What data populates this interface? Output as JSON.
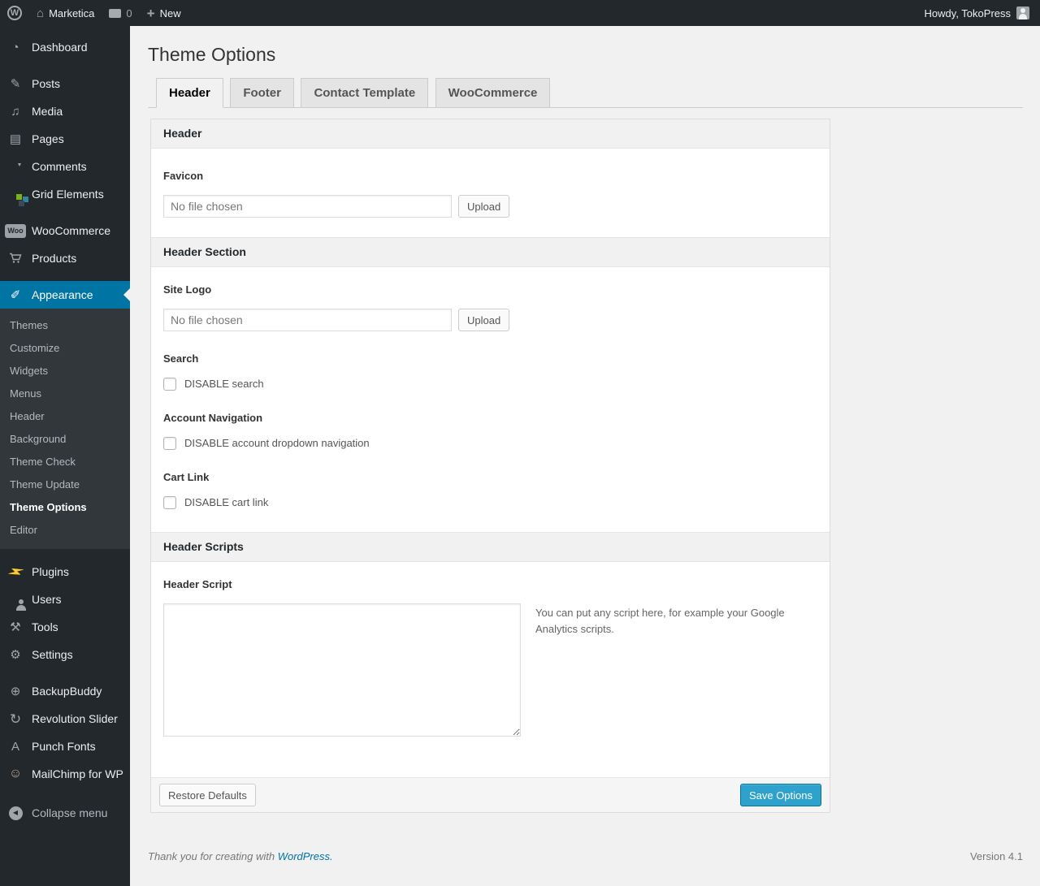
{
  "colors": {
    "accent": "#0074a2",
    "primary_button": "#2ea2cc",
    "admin_dark": "#23282d"
  },
  "admin_bar": {
    "site_name": "Marketica",
    "comment_count": "0",
    "new_label": "New",
    "howdy": "Howdy, TokoPress"
  },
  "icons": {
    "wordpress_logo": "W",
    "home": "⌂",
    "plus": "+",
    "dashboard": "◔",
    "posts": "✎",
    "media": "♫",
    "pages": "▤",
    "woo_badge": "Woo",
    "appearance": "✐",
    "plugins": "⚡",
    "tools": "⚒",
    "settings": "⚙",
    "backupbuddy": "⊕",
    "revolution_slider": "↻",
    "punch_fonts": "A",
    "mailchimp": "☺",
    "collapse": "◀"
  },
  "sidebar": {
    "items": [
      "Dashboard",
      "Posts",
      "Media",
      "Pages",
      "Comments",
      "Grid Elements",
      "WooCommerce",
      "Products",
      "Appearance",
      "Plugins",
      "Users",
      "Tools",
      "Settings",
      "BackupBuddy",
      "Revolution Slider",
      "Punch Fonts",
      "MailChimp for WP",
      "Collapse menu"
    ],
    "appearance_submenu": [
      "Themes",
      "Customize",
      "Widgets",
      "Menus",
      "Header",
      "Background",
      "Theme Check",
      "Theme Update",
      "Theme Options",
      "Editor"
    ],
    "current_submenu_item": "Theme Options"
  },
  "page": {
    "title": "Theme Options",
    "tabs": [
      "Header",
      "Footer",
      "Contact Template",
      "WooCommerce"
    ],
    "active_tab": "Header"
  },
  "panel": {
    "sections": [
      {
        "title": "Header"
      },
      {
        "title": "Header Section"
      },
      {
        "title": "Header Scripts"
      }
    ],
    "favicon": {
      "label": "Favicon",
      "placeholder": "No file chosen",
      "upload": "Upload"
    },
    "site_logo": {
      "label": "Site Logo",
      "placeholder": "No file chosen",
      "upload": "Upload"
    },
    "search": {
      "label": "Search",
      "checkbox": "DISABLE search"
    },
    "account": {
      "label": "Account Navigation",
      "checkbox": "DISABLE account dropdown navigation"
    },
    "cart": {
      "label": "Cart Link",
      "checkbox": "DISABLE cart link"
    },
    "script": {
      "label": "Header Script",
      "note": "You can put any script here, for example your Google Analytics scripts."
    },
    "footer": {
      "restore": "Restore Defaults",
      "save": "Save Options"
    }
  },
  "footer": {
    "thank_you_prefix": "Thank you for creating with ",
    "wordpress_link": "WordPress.",
    "version": "Version 4.1"
  }
}
